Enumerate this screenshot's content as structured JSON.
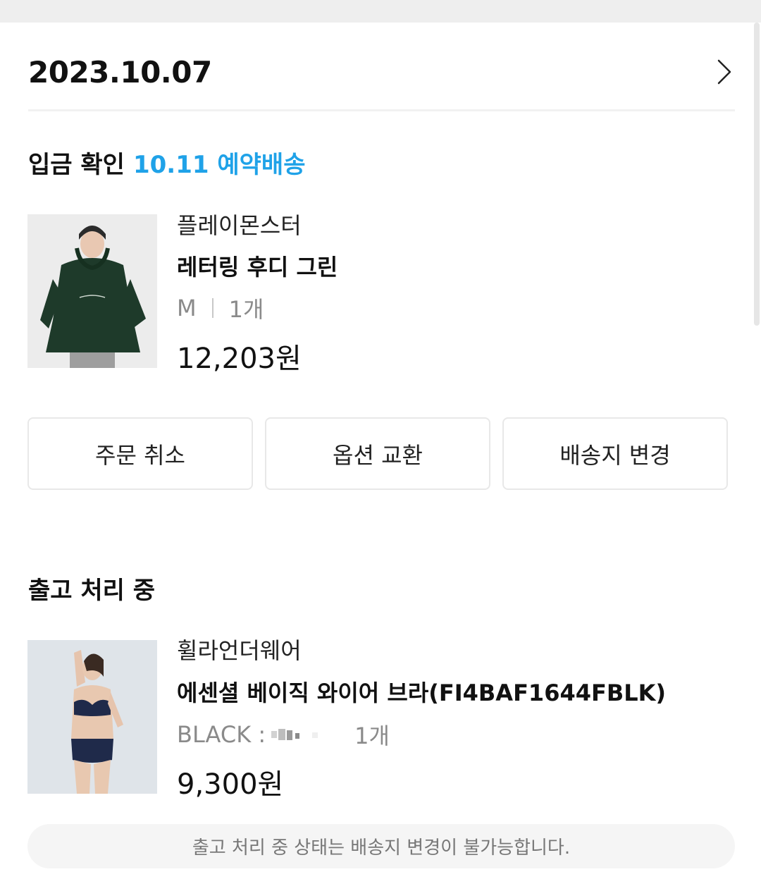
{
  "order": {
    "date": "2023.10.07"
  },
  "sections": [
    {
      "status": "입금 확인",
      "delivery_note": "10.11 예약배송",
      "item": {
        "brand": "플레이몬스터",
        "name": "레터링 후디 그린",
        "option": "M",
        "quantity": "1개",
        "price": "12,203원",
        "thumbnail_icon": "green-hoodie-model-photo"
      },
      "actions": [
        "주문 취소",
        "옵션 교환",
        "배송지 변경"
      ]
    },
    {
      "status": "출고 처리 중",
      "item": {
        "brand": "휠라언더웨어",
        "name": "에센셜 베이직 와이어 브라(FI4BAF1644FBLK)",
        "option": "BLACK :",
        "quantity": "1개",
        "price": "9,300원",
        "thumbnail_icon": "navy-underwear-model-photo"
      },
      "notice": "출고 처리 중 상태는 배송지 변경이 불가능합니다."
    }
  ],
  "icons": {
    "detail": "chevron-right-icon"
  },
  "colors": {
    "accent": "#1fa2e8",
    "text": "#111111",
    "muted": "#8a8a8a",
    "border": "#e8e8e8"
  }
}
